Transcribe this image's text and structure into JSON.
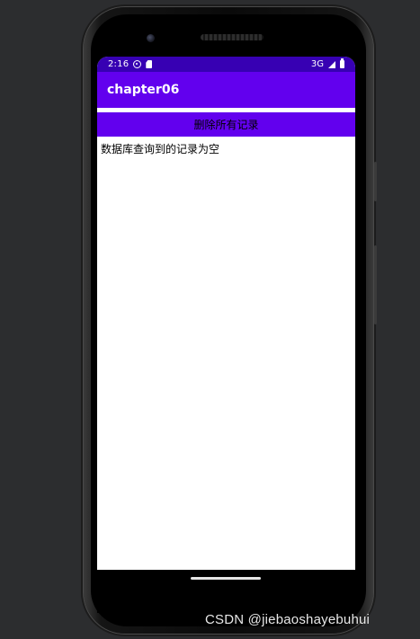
{
  "status_bar": {
    "time": "2:16",
    "network": "3G",
    "icons": [
      "settings-icon",
      "sd-card-icon",
      "signal-icon",
      "battery-icon"
    ]
  },
  "app_bar": {
    "title": "chapter06"
  },
  "main": {
    "delete_button_label": "删除所有记录",
    "result_text": "数据库查询到的记录为空"
  },
  "watermark": "CSDN @jiebaoshayebuhui",
  "colors": {
    "status_bar": "#3700b3",
    "app_bar": "#6200ee",
    "button": "#6200ee",
    "background": "#2c2d2f"
  }
}
